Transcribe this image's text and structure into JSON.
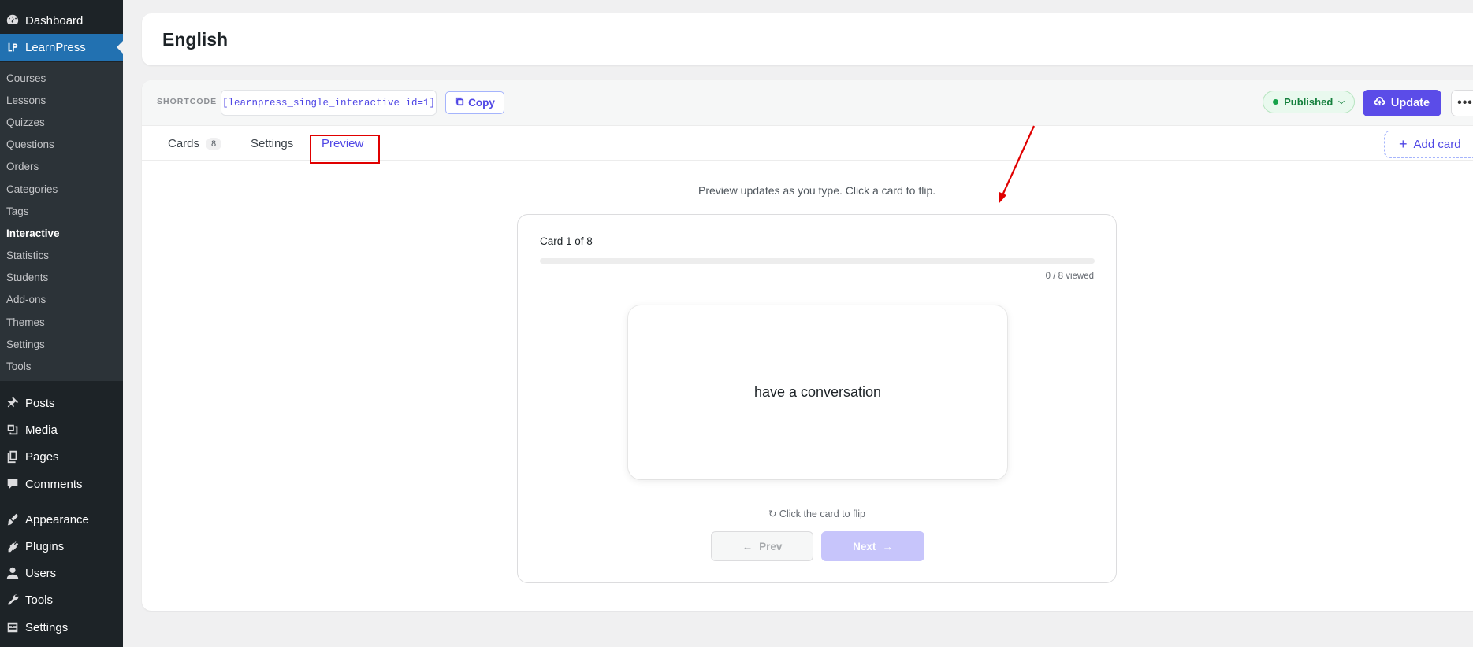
{
  "sidebar": {
    "top_items": [
      {
        "label": "Dashboard",
        "icon": "dashboard-icon"
      },
      {
        "label": "LearnPress",
        "icon": "learnpress-icon",
        "active": true
      }
    ],
    "submenu": [
      "Courses",
      "Lessons",
      "Quizzes",
      "Questions",
      "Orders",
      "Categories",
      "Tags",
      "Interactive",
      "Statistics",
      "Students",
      "Add-ons",
      "Themes",
      "Settings",
      "Tools"
    ],
    "current_submenu": "Interactive",
    "bottom_items": [
      {
        "label": "Posts",
        "icon": "pin-icon"
      },
      {
        "label": "Media",
        "icon": "media-icon"
      },
      {
        "label": "Pages",
        "icon": "pages-icon"
      },
      {
        "label": "Comments",
        "icon": "comments-icon"
      },
      {
        "label": "Appearance",
        "icon": "brush-icon"
      },
      {
        "label": "Plugins",
        "icon": "plugin-icon"
      },
      {
        "label": "Users",
        "icon": "user-icon"
      },
      {
        "label": "Tools",
        "icon": "wrench-icon"
      },
      {
        "label": "Settings",
        "icon": "settings-icon"
      }
    ]
  },
  "page": {
    "title": "English"
  },
  "toolbar": {
    "shortcode_label": "SHORTCODE",
    "shortcode_value": "[learnpress_single_interactive id=1]",
    "copy_label": "Copy",
    "status_label": "Published",
    "update_label": "Update",
    "more_label": "•••"
  },
  "tabs": {
    "cards_label": "Cards",
    "cards_count": "8",
    "settings_label": "Settings",
    "preview_label": "Preview",
    "active": "Preview",
    "add_card_label": "Add card"
  },
  "preview": {
    "hint": "Preview updates as you type. Click a card to flip.",
    "card_counter": "Card 1 of 8",
    "progress_fraction": 0,
    "viewed_text": "0 / 8 viewed",
    "card_front": "have a conversation",
    "flip_hint": "↻ Click the card to flip",
    "prev_label": "Prev",
    "next_label": "Next"
  },
  "colors": {
    "accent": "#5b4ce8",
    "sidebar_bg": "#1d2327",
    "sidebar_active": "#2271b1",
    "published_green": "#15803d",
    "annotation_red": "#e00000"
  }
}
